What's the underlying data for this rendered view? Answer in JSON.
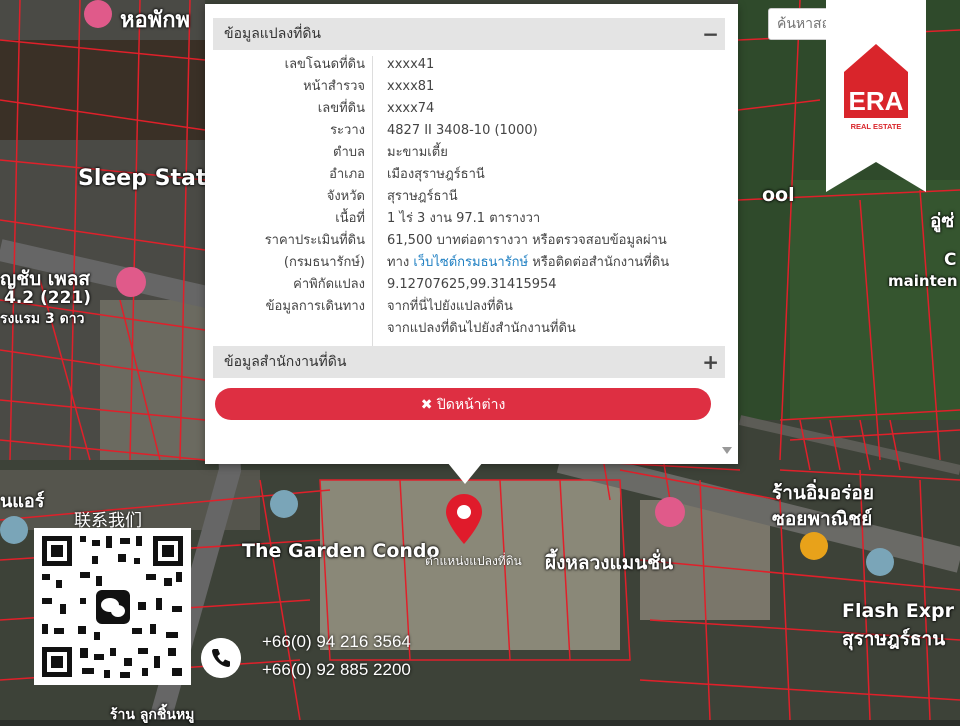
{
  "search": {
    "placeholder": "ค้นหาสถ"
  },
  "brand": {
    "logo_text": "ERA",
    "tagline": "REAL ESTATE",
    "accent": "#d9252b"
  },
  "popup": {
    "section1_title": "ข้อมูลแปลงที่ดิน",
    "section1_toggle": "−",
    "rows": [
      {
        "label": "เลขโฉนดที่ดิน",
        "value": "xxxx41"
      },
      {
        "label": "หน้าสำรวจ",
        "value": "xxxx81"
      },
      {
        "label": "เลขที่ดิน",
        "value": "xxxx74"
      },
      {
        "label": "ระวาง",
        "value": "4827 II 3408-10 (1000)"
      },
      {
        "label": "ตำบล",
        "value": "มะขามเตี้ย"
      },
      {
        "label": "อำเภอ",
        "value": "เมืองสุราษฎร์ธานี"
      },
      {
        "label": "จังหวัด",
        "value": "สุราษฎร์ธานี"
      },
      {
        "label": "เนื้อที่",
        "value": "1 ไร่ 3 งาน 97.1 ตารางวา"
      },
      {
        "label": "ราคาประเมินที่ดิน",
        "value": "61,500 บาทต่อตารางวา หรือตรวจสอบข้อมูลผ่าน"
      },
      {
        "label": "(กรมธนารักษ์)",
        "value_prefix": "ทาง ",
        "value_link": "เว็บไซต์กรมธนารักษ์",
        "value_suffix": " หรือติดต่อสำนักงานที่ดิน"
      },
      {
        "label": "ค่าพิกัดแปลง",
        "link": "9.12707625,99.31415954"
      },
      {
        "label": "ข้อมูลการเดินทาง",
        "link": "จากที่นี่ไปยังแปลงที่ดิน"
      },
      {
        "label": "",
        "link": "จากแปลงที่ดินไปยังสำนักงานที่ดิน"
      }
    ],
    "section2_title": "ข้อมูลสำนักงานที่ดิน",
    "section2_toggle": "+",
    "close_label": "✖ ปิดหน้าต่าง"
  },
  "map": {
    "labels": [
      "หอพักพ",
      "Sleep Stati",
      "ญชับ เพลส",
      "4.2  (221)",
      "รงแรม 3 ดาว",
      "นแอร์",
      "The Garden Condo",
      "ผึ้งหลวงแมนชั่น",
      "ร้านอิ่มอร่อย",
      "ซอยพาณิชย์",
      "Flash Expr",
      "สุราษฎร์ธาน",
      "ool",
      "อู่ซ่",
      "C",
      "mainten",
      "ร้าน ลูกชิ้นหมู"
    ],
    "pin_label": "ตำแหน่งแปลงที่ดิน"
  },
  "contact": {
    "qr_label": "联系我们",
    "phones": [
      "+66(0) 94 216 3564",
      "+66(0) 92 885 2200"
    ]
  }
}
